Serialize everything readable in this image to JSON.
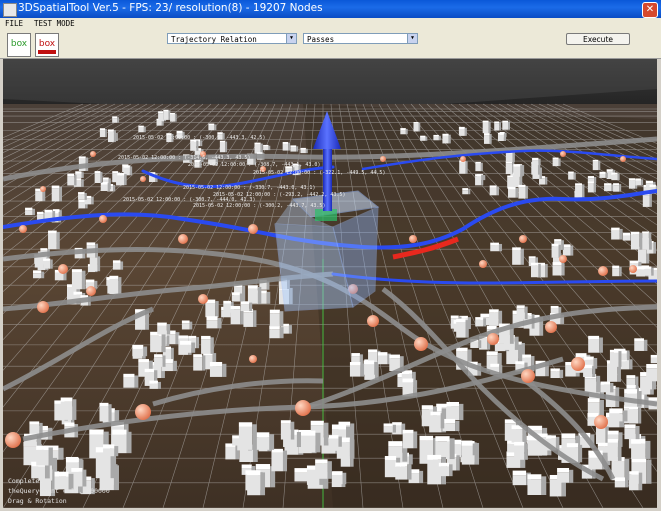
{
  "window": {
    "title": "3DSpatialTool Ver.5 - FPS: 23/ resolution(8) - 19207 Nodes",
    "close_glyph": "✕"
  },
  "menu": {
    "items": [
      "FILE",
      "TEST MODE"
    ]
  },
  "toolbar": {
    "box_button_label": "box",
    "box_remove_button_label": "box",
    "relation_select": {
      "value": "Trajectory Relation"
    },
    "predicate_select": {
      "value": "Passes"
    },
    "execute_label": "Execute",
    "dropdown_glyph": "▼"
  },
  "viewport": {
    "status_lines": [
      "Complete.",
      "theQueryCount = 19, 000000",
      "Drag & Rotation"
    ],
    "annotations": [
      "2015-05-02 12:00:00 : (-300.5, -443.3, 42.5)",
      "2015-05-02 12:00:00 : (-314.6, -443.3, 43.5)",
      "2015-05-02 12:00:00 : (-330.7, -443.0, 43.1)",
      "2015-05-02 12:00:00 : (-300.7, -444.0, 41.3)",
      "2015-05-02 12:00:00 : (-308.7, -443.1, 43.0)",
      "2015-05-02 12:00:00 : (-322.1, -449.5, 44.5)",
      "2015-05-02 12:00:00 : (-293.2, -442.2, 43.5)",
      "2015-05-02 12:00:00 : (-300.2, -443.7, 43.5)"
    ],
    "colors": {
      "sky": "#2a2a2a",
      "ground": "#4a3a2a",
      "grid": "#b8b8b8",
      "road": "#8a8a8a",
      "trajectory": "#2244ee",
      "node": "#f0926a",
      "query_box": "#9fc6ff",
      "arrow": "#2233dd",
      "building": "#f2f2f2"
    }
  }
}
